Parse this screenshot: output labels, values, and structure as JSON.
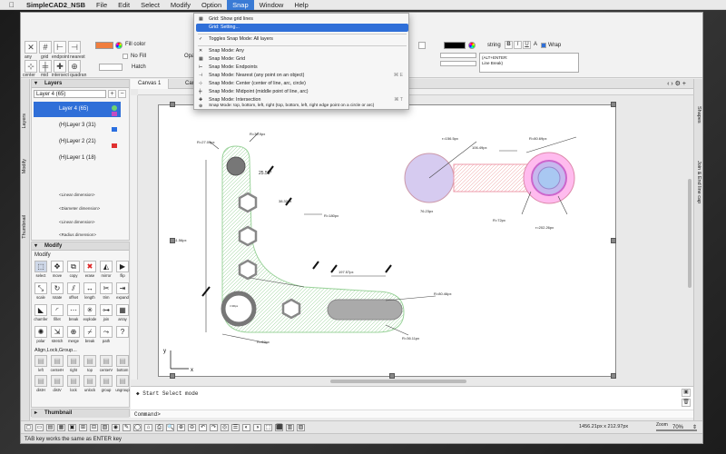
{
  "menubar": {
    "app_name": "SimpleCAD2_NSB",
    "items": [
      "File",
      "Edit",
      "Select",
      "Modify",
      "Option",
      "Snap",
      "Window",
      "Help"
    ],
    "active": "Snap"
  },
  "toolbar": {
    "snap_labels": [
      "any",
      "grid",
      "endpoint",
      "nearest",
      "center",
      "mid",
      "intersect",
      "quadran"
    ],
    "fill_color_label": "Fill color",
    "no_fill_label": "No Fill",
    "hatch_label": "Hatch",
    "opacity_label": "Opac",
    "string_label": "string",
    "bold": "B",
    "italic": "I",
    "underline": "U",
    "wrap_label": "Wrap",
    "alt_enter_label": "(ALT+ENTER:",
    "line_break_label": "Line Break)",
    "fill_color_hex": "#f07e3e"
  },
  "snap_menu": {
    "items": [
      {
        "label": "Grid: Show grid lines",
        "shortcut": "",
        "icon": "grid-icon"
      },
      {
        "label": "Grid: Setting...",
        "shortcut": "",
        "icon": "",
        "highlighted": true
      },
      {
        "label": "Toggles Snap Mode: All layers",
        "shortcut": "",
        "icon": "",
        "checked": true
      },
      {
        "label": "Snap Mode: Any",
        "shortcut": "",
        "icon": "close-icon"
      },
      {
        "label": "Snap Mode: Grid",
        "shortcut": "",
        "icon": "grid-icon"
      },
      {
        "label": "Snap Mode: Endpoints",
        "shortcut": "",
        "icon": "endpoint-icon"
      },
      {
        "label": "Snap Mode: Nearest (any point on an object)",
        "shortcut": "⌘ E",
        "icon": "nearest-icon"
      },
      {
        "label": "Snap Mode: Center (center of line, arc, circle)",
        "shortcut": "",
        "icon": "center-icon"
      },
      {
        "label": "Snap Mode: Midpoint (middle point of line, arc)",
        "shortcut": "",
        "icon": "midpoint-icon"
      },
      {
        "label": "Snap Mode: Intersection",
        "shortcut": "⌘ T",
        "icon": "intersection-icon"
      },
      {
        "label": "Snap Mode: top, bottom, left, right (top, bottom, left, right edge point on a circle or arc)",
        "shortcut": "⌘ Q",
        "icon": "quadrant-icon"
      }
    ]
  },
  "layers_panel": {
    "title": "Layers",
    "current": "Layer 4 (65)",
    "rows": [
      {
        "label": "Layer 4 (65)",
        "selected": true
      },
      {
        "label": "(H)Layer 3 (31)",
        "selected": false
      },
      {
        "label": "(H)Layer 2 (21)",
        "selected": false
      },
      {
        "label": "(H)Layer 1 (18)",
        "selected": false
      }
    ],
    "sub_items": [
      "<Linear dimension>",
      "<Diameter dimension>",
      "<Linear dimension>",
      "<Radius dimension>"
    ]
  },
  "modify_panel": {
    "title": "Modify",
    "subtitle": "Modify",
    "tools": [
      "select",
      "move",
      "copy",
      "erase",
      "mirror",
      "flip",
      "scale",
      "rotate",
      "offset",
      "length",
      "trim",
      "expand",
      "chamfer",
      "fillet",
      "break",
      "explode",
      "join",
      "array",
      "polar",
      "stretch",
      "merge",
      "break",
      "path",
      ""
    ],
    "group_label": "Align,Lock,Group...",
    "align_tools": [
      "left",
      "centerH",
      "right",
      "top",
      "centerV",
      "bottom",
      "distH",
      "distV",
      "lock",
      "unlock",
      "group",
      "ungroup"
    ]
  },
  "collapsed_panels": [
    "Thumbnail",
    "Size & Position"
  ],
  "left_tabs": [
    "Layers",
    "Modify",
    "Thumbnail"
  ],
  "right_tabs": [
    "Shapes",
    "Join & End line cap"
  ],
  "canvas": {
    "tabs": [
      "Canvas 1",
      "Can"
    ],
    "dims": {
      "r1": "R=27.05px",
      "r2": "R=30.9px",
      "angle": "25.58°",
      "d1": "38.32px",
      "len1": "481.56px",
      "r3": "R=180px",
      "len2": "197.57px",
      "r4": "R=80.46px",
      "r5": "R=69px",
      "r6": "R=36.11px",
      "hole": "r=30px",
      "r7": "r=156.5px",
      "len3": "106.49px",
      "r8": "R=80.69px",
      "d2": "76.23px",
      "r9": "R=72px",
      "r10": "r=202.26px"
    }
  },
  "console": {
    "line": "◆ Start Select mode",
    "command_label": "Command>"
  },
  "bottom": {
    "coords": "1456.21px x 212.97px",
    "zoom_label": "Zoom",
    "zoom_value": "70%"
  },
  "status_text": "TAB key works the same as ENTER key"
}
